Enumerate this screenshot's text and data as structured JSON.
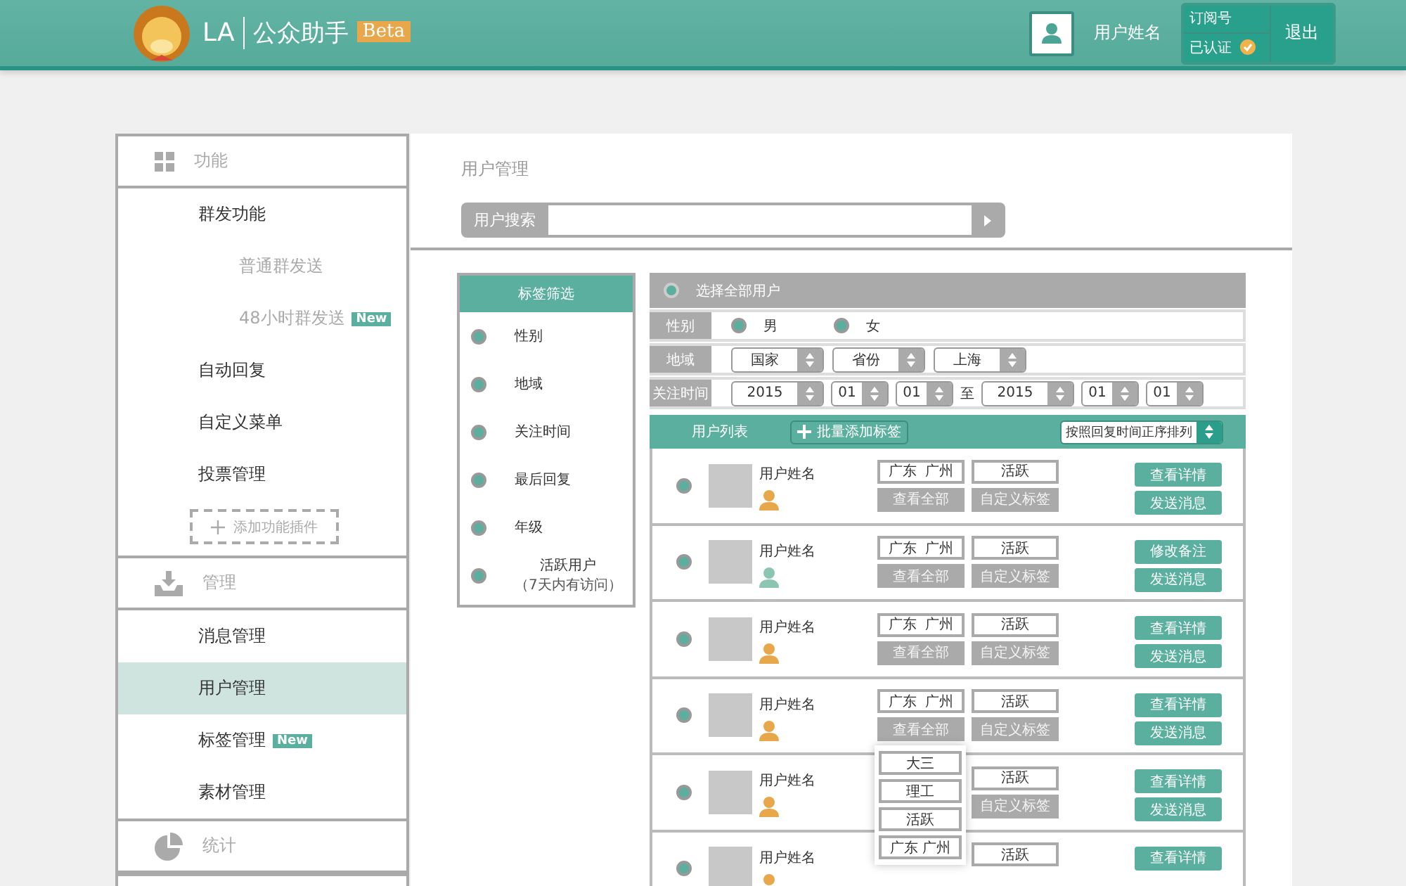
{
  "header": {
    "logo_text": "LA",
    "app_name": "公众助手",
    "badge": "Beta",
    "user_name": "用户姓名",
    "account_type": "订阅号",
    "verified_label": "已认证",
    "logout": "退出"
  },
  "sidebar": {
    "sections": [
      {
        "title": "功能",
        "items": [
          {
            "label": "群发功能",
            "selected": false,
            "children": [
              {
                "label": "普通群发送",
                "selected": false
              },
              {
                "label": "48小时群发送",
                "badge": "New",
                "selected": false
              }
            ]
          },
          {
            "label": "自动回复",
            "selected": false
          },
          {
            "label": "自定义菜单",
            "selected": false
          },
          {
            "label": "投票管理",
            "selected": false
          }
        ],
        "add_button": "添加功能插件"
      },
      {
        "title": "管理",
        "items": [
          {
            "label": "消息管理",
            "selected": false
          },
          {
            "label": "用户管理",
            "selected": true
          },
          {
            "label": "标签管理",
            "badge": "New",
            "selected": false
          },
          {
            "label": "素材管理",
            "selected": false
          }
        ]
      },
      {
        "title": "统计"
      }
    ]
  },
  "page": {
    "title": "用户管理",
    "search_label": "用户搜索"
  },
  "filter_panel": {
    "title": "标签筛选",
    "items": [
      {
        "label": "性别",
        "selected": true
      },
      {
        "label": "地域",
        "selected": true
      },
      {
        "label": "关注时间",
        "selected": true
      },
      {
        "label": "最后回复",
        "selected": true
      },
      {
        "label": "年级",
        "selected": true
      },
      {
        "label": "活跃用户",
        "note": "（7天内有访问）",
        "selected": true
      }
    ]
  },
  "criteria": {
    "select_all": {
      "label": "选择全部用户",
      "selected": true
    },
    "gender": {
      "label": "性别",
      "options": [
        {
          "label": "男",
          "selected": true
        },
        {
          "label": "女",
          "selected": true
        }
      ]
    },
    "region": {
      "label": "地域",
      "selects": [
        "国家",
        "省份",
        "上海"
      ]
    },
    "follow_time": {
      "label": "关注时间",
      "from": [
        "2015",
        "01",
        "01"
      ],
      "separator": "至",
      "to": [
        "2015",
        "01",
        "01"
      ]
    }
  },
  "user_list": {
    "title": "用户列表",
    "bulk_button": "批量添加标签",
    "sort": "按照回复时间正序排列",
    "rows": [
      {
        "name": "用户姓名",
        "color": "#e8a74a",
        "selected": true,
        "location": "广东  广州",
        "status_tag": "活跃",
        "view_all": "查看全部",
        "custom_tag": "自定义标签",
        "primary": "查看详情",
        "secondary": "发送消息"
      },
      {
        "name": "用户姓名",
        "color": "#8cc5b2",
        "selected": true,
        "location": "广东  广州",
        "status_tag": "活跃",
        "view_all": "查看全部",
        "custom_tag": "自定义标签",
        "primary": "修改备注",
        "secondary": "发送消息"
      },
      {
        "name": "用户姓名",
        "color": "#e8a74a",
        "selected": true,
        "location": "广东  广州",
        "status_tag": "活跃",
        "view_all": "查看全部",
        "custom_tag": "自定义标签",
        "primary": "查看详情",
        "secondary": "发送消息"
      },
      {
        "name": "用户姓名",
        "color": "#e8a74a",
        "selected": true,
        "location": "广东  广州",
        "status_tag": "活跃",
        "view_all": "查看全部",
        "custom_tag": "自定义标签",
        "primary": "查看详情",
        "secondary": "发送消息",
        "tag_popup": [
          "大三",
          "理工",
          "活跃",
          "广东 广州"
        ]
      },
      {
        "name": "用户姓名",
        "color": "#e8a74a",
        "selected": true,
        "status_tag": "活跃",
        "custom_tag": "自定义标签",
        "primary": "查看详情",
        "secondary": "发送消息"
      },
      {
        "name": "用户姓名",
        "color": "#e8a74a",
        "selected": true,
        "status_tag": "活跃",
        "primary": "查看详情"
      }
    ]
  }
}
